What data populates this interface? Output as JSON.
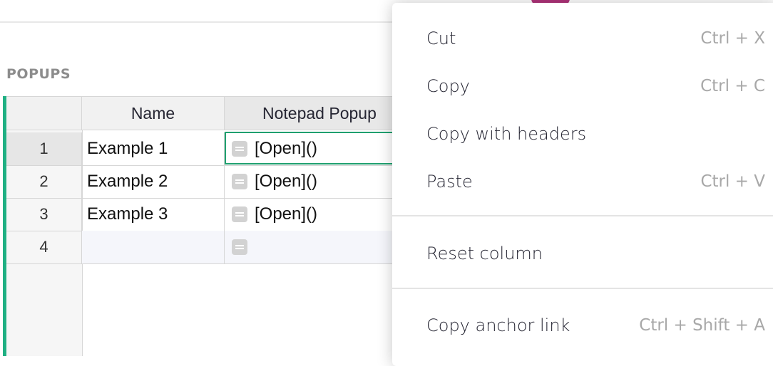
{
  "section": {
    "title": "POPUPS"
  },
  "table": {
    "columns": [
      "Name",
      "Notepad Popup"
    ],
    "rows": [
      {
        "num": "1",
        "name": "Example 1",
        "popup": "[Open]()"
      },
      {
        "num": "2",
        "name": "Example 2",
        "popup": "[Open]()"
      },
      {
        "num": "3",
        "name": "Example 3",
        "popup": "[Open]()"
      },
      {
        "num": "4",
        "name": "",
        "popup": ""
      }
    ]
  },
  "context_menu": {
    "items": [
      {
        "label": "Cut",
        "shortcut": "Ctrl + X"
      },
      {
        "label": "Copy",
        "shortcut": "Ctrl + C"
      },
      {
        "label": "Copy with headers",
        "shortcut": ""
      },
      {
        "label": "Paste",
        "shortcut": "Ctrl + V"
      },
      {
        "label": "Reset column",
        "shortcut": ""
      },
      {
        "label": "Copy anchor link",
        "shortcut": "Ctrl + Shift + A"
      }
    ]
  },
  "colors": {
    "accent": "#1fb083",
    "active_cell_border": "#1fa06f",
    "highlight": "#ffe800"
  },
  "icons": {
    "cell_button": "text-lines-icon"
  }
}
